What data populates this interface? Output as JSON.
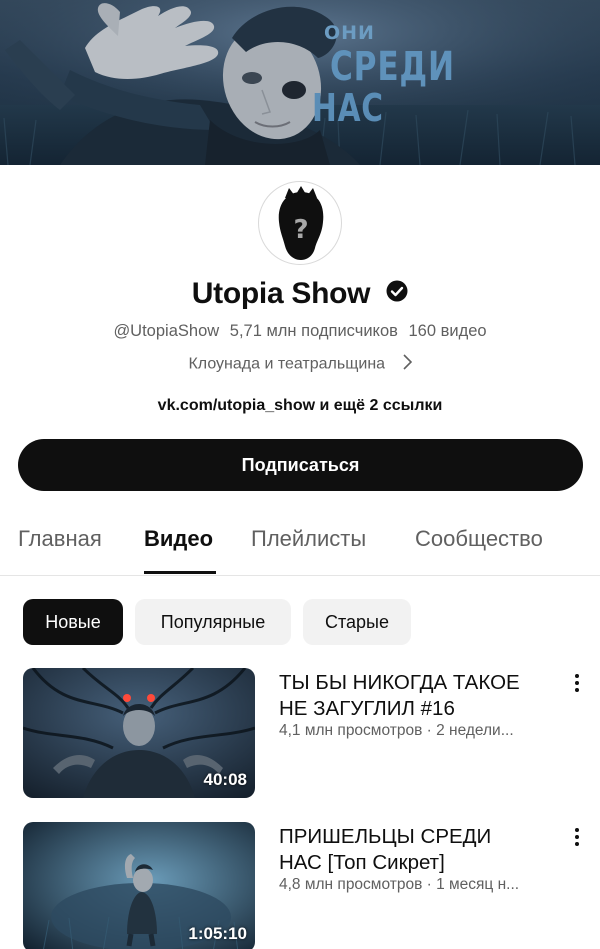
{
  "banner": {
    "line1": "ОНИ",
    "line2": "СРЕДИ",
    "line3": "НАС"
  },
  "channel": {
    "name": "Utopia Show",
    "handle": "@UtopiaShow",
    "subscribers": "5,71 млн подписчиков",
    "videos_count": "160 видео",
    "category": "Клоунада и театральщина",
    "links": "vk.com/utopia_show и ещё 2 ссылки",
    "subscribe_label": "Подписаться"
  },
  "tabs": [
    {
      "label": "Главная",
      "active": false
    },
    {
      "label": "Видео",
      "active": true
    },
    {
      "label": "Плейлисты",
      "active": false
    },
    {
      "label": "Сообщество",
      "active": false
    }
  ],
  "chips": [
    {
      "label": "Новые",
      "active": true
    },
    {
      "label": "Популярные",
      "active": false
    },
    {
      "label": "Старые",
      "active": false
    }
  ],
  "videos": [
    {
      "title_line1": "ТЫ БЫ НИКОГДА ТАКОЕ",
      "title_line2": "НЕ ЗАГУГЛИЛ #16",
      "meta": "4,1 млн просмотров · 2 недели...",
      "duration": "40:08"
    },
    {
      "title_line1": "ПРИШЕЛЬЦЫ СРЕДИ",
      "title_line2": "НАС [Топ Сикрет]",
      "meta": "4,8 млн просмотров · 1 месяц н...",
      "duration": "1:05:10"
    }
  ],
  "icons": {
    "verified": "verified-check-icon",
    "category_chevron": "chevron-right-icon",
    "more": "more-vertical-icon"
  },
  "colors": {
    "primary_text": "#0f0f0f",
    "secondary_text": "#606060",
    "chip_bg": "#f2f2f2",
    "subscribe_bg": "#0f0f0f"
  }
}
